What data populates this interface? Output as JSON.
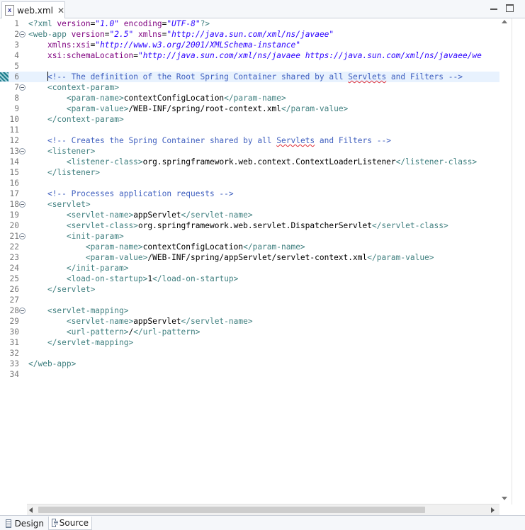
{
  "editor_tab": {
    "title": "web.xml",
    "file_icon": "xml-file-icon",
    "close_glyph": "✕"
  },
  "bottom_tabs": {
    "design": "Design",
    "source": "Source"
  },
  "colors": {
    "tag": "#3f7f7f",
    "attribute": "#7f007f",
    "value": "#2a00ff",
    "comment": "#3f5fbf",
    "text": "#000000",
    "line_number": "#787878",
    "current_line": "#e8f2fe"
  },
  "lines": [
    {
      "n": "1",
      "fold": false,
      "tokens": [
        {
          "t": "t",
          "s": "<?xml "
        },
        {
          "t": "a",
          "s": "version"
        },
        {
          "t": "x",
          "s": "="
        },
        {
          "t": "v",
          "s": "\"1.0\""
        },
        {
          "t": "x",
          "s": " "
        },
        {
          "t": "a",
          "s": "encoding"
        },
        {
          "t": "x",
          "s": "="
        },
        {
          "t": "v",
          "s": "\"UTF-8\""
        },
        {
          "t": "t",
          "s": "?>"
        }
      ]
    },
    {
      "n": "2",
      "fold": true,
      "tokens": [
        {
          "t": "t",
          "s": "<web-app "
        },
        {
          "t": "a",
          "s": "version"
        },
        {
          "t": "x",
          "s": "="
        },
        {
          "t": "v",
          "s": "\"2.5\""
        },
        {
          "t": "x",
          "s": " "
        },
        {
          "t": "a",
          "s": "xmlns"
        },
        {
          "t": "x",
          "s": "="
        },
        {
          "t": "v",
          "s": "\"http://java.sun.com/xml/ns/javaee\""
        }
      ]
    },
    {
      "n": "3",
      "fold": false,
      "tokens": [
        {
          "t": "x",
          "s": "    "
        },
        {
          "t": "a",
          "s": "xmlns:xsi"
        },
        {
          "t": "x",
          "s": "="
        },
        {
          "t": "v",
          "s": "\"http://www.w3.org/2001/XMLSchema-instance\""
        }
      ]
    },
    {
      "n": "4",
      "fold": false,
      "tokens": [
        {
          "t": "x",
          "s": "    "
        },
        {
          "t": "a",
          "s": "xsi:schemaLocation"
        },
        {
          "t": "x",
          "s": "="
        },
        {
          "t": "v",
          "s": "\"http://java.sun.com/xml/ns/javaee https://java.sun.com/xml/ns/javaee/we"
        }
      ]
    },
    {
      "n": "5",
      "fold": false,
      "tokens": []
    },
    {
      "n": "6",
      "fold": false,
      "current": true,
      "marker": true,
      "tokens": [
        {
          "t": "x",
          "s": "    "
        },
        {
          "t": "caret",
          "s": ""
        },
        {
          "t": "c",
          "s": "<!-- The definition of the Root Spring Container shared by all "
        },
        {
          "t": "c",
          "s": "Servlets",
          "squig": true
        },
        {
          "t": "c",
          "s": " and Filters -->"
        }
      ]
    },
    {
      "n": "7",
      "fold": true,
      "tokens": [
        {
          "t": "x",
          "s": "    "
        },
        {
          "t": "t",
          "s": "<context-param>"
        }
      ]
    },
    {
      "n": "8",
      "fold": false,
      "tokens": [
        {
          "t": "x",
          "s": "        "
        },
        {
          "t": "t",
          "s": "<param-name>"
        },
        {
          "t": "x",
          "s": "contextConfigLocation"
        },
        {
          "t": "t",
          "s": "</param-name>"
        }
      ]
    },
    {
      "n": "9",
      "fold": false,
      "tokens": [
        {
          "t": "x",
          "s": "        "
        },
        {
          "t": "t",
          "s": "<param-value>"
        },
        {
          "t": "x",
          "s": "/WEB-INF/spring/root-context.xml"
        },
        {
          "t": "t",
          "s": "</param-value>"
        }
      ]
    },
    {
      "n": "10",
      "fold": false,
      "tokens": [
        {
          "t": "x",
          "s": "    "
        },
        {
          "t": "t",
          "s": "</context-param>"
        }
      ]
    },
    {
      "n": "11",
      "fold": false,
      "tokens": []
    },
    {
      "n": "12",
      "fold": false,
      "tokens": [
        {
          "t": "x",
          "s": "    "
        },
        {
          "t": "c",
          "s": "<!-- Creates the Spring Container shared by all "
        },
        {
          "t": "c",
          "s": "Servlets",
          "squig": true
        },
        {
          "t": "c",
          "s": " and Filters -->"
        }
      ]
    },
    {
      "n": "13",
      "fold": true,
      "tokens": [
        {
          "t": "x",
          "s": "    "
        },
        {
          "t": "t",
          "s": "<listener>"
        }
      ]
    },
    {
      "n": "14",
      "fold": false,
      "tokens": [
        {
          "t": "x",
          "s": "        "
        },
        {
          "t": "t",
          "s": "<listener-class>"
        },
        {
          "t": "x",
          "s": "org.springframework.web.context.ContextLoaderListener"
        },
        {
          "t": "t",
          "s": "</listener-class>"
        }
      ]
    },
    {
      "n": "15",
      "fold": false,
      "tokens": [
        {
          "t": "x",
          "s": "    "
        },
        {
          "t": "t",
          "s": "</listener>"
        }
      ]
    },
    {
      "n": "16",
      "fold": false,
      "tokens": []
    },
    {
      "n": "17",
      "fold": false,
      "tokens": [
        {
          "t": "x",
          "s": "    "
        },
        {
          "t": "c",
          "s": "<!-- Processes application requests -->"
        }
      ]
    },
    {
      "n": "18",
      "fold": true,
      "tokens": [
        {
          "t": "x",
          "s": "    "
        },
        {
          "t": "t",
          "s": "<servlet>"
        }
      ]
    },
    {
      "n": "19",
      "fold": false,
      "tokens": [
        {
          "t": "x",
          "s": "        "
        },
        {
          "t": "t",
          "s": "<servlet-name>"
        },
        {
          "t": "x",
          "s": "appServlet"
        },
        {
          "t": "t",
          "s": "</servlet-name>"
        }
      ]
    },
    {
      "n": "20",
      "fold": false,
      "tokens": [
        {
          "t": "x",
          "s": "        "
        },
        {
          "t": "t",
          "s": "<servlet-class>"
        },
        {
          "t": "x",
          "s": "org.springframework.web.servlet.DispatcherServlet"
        },
        {
          "t": "t",
          "s": "</servlet-class>"
        }
      ]
    },
    {
      "n": "21",
      "fold": true,
      "tokens": [
        {
          "t": "x",
          "s": "        "
        },
        {
          "t": "t",
          "s": "<init-param>"
        }
      ]
    },
    {
      "n": "22",
      "fold": false,
      "tokens": [
        {
          "t": "x",
          "s": "            "
        },
        {
          "t": "t",
          "s": "<param-name>"
        },
        {
          "t": "x",
          "s": "contextConfigLocation"
        },
        {
          "t": "t",
          "s": "</param-name>"
        }
      ]
    },
    {
      "n": "23",
      "fold": false,
      "tokens": [
        {
          "t": "x",
          "s": "            "
        },
        {
          "t": "t",
          "s": "<param-value>"
        },
        {
          "t": "x",
          "s": "/WEB-INF/spring/appServlet/servlet-context.xml"
        },
        {
          "t": "t",
          "s": "</param-value>"
        }
      ]
    },
    {
      "n": "24",
      "fold": false,
      "tokens": [
        {
          "t": "x",
          "s": "        "
        },
        {
          "t": "t",
          "s": "</init-param>"
        }
      ]
    },
    {
      "n": "25",
      "fold": false,
      "tokens": [
        {
          "t": "x",
          "s": "        "
        },
        {
          "t": "t",
          "s": "<load-on-startup>"
        },
        {
          "t": "x",
          "s": "1"
        },
        {
          "t": "t",
          "s": "</load-on-startup>"
        }
      ]
    },
    {
      "n": "26",
      "fold": false,
      "tokens": [
        {
          "t": "x",
          "s": "    "
        },
        {
          "t": "t",
          "s": "</servlet>"
        }
      ]
    },
    {
      "n": "27",
      "fold": false,
      "tokens": []
    },
    {
      "n": "28",
      "fold": true,
      "tokens": [
        {
          "t": "x",
          "s": "    "
        },
        {
          "t": "t",
          "s": "<servlet-mapping>"
        }
      ]
    },
    {
      "n": "29",
      "fold": false,
      "tokens": [
        {
          "t": "x",
          "s": "        "
        },
        {
          "t": "t",
          "s": "<servlet-name>"
        },
        {
          "t": "x",
          "s": "appServlet"
        },
        {
          "t": "t",
          "s": "</servlet-name>"
        }
      ]
    },
    {
      "n": "30",
      "fold": false,
      "tokens": [
        {
          "t": "x",
          "s": "        "
        },
        {
          "t": "t",
          "s": "<url-pattern>"
        },
        {
          "t": "x",
          "s": "/"
        },
        {
          "t": "t",
          "s": "</url-pattern>"
        }
      ]
    },
    {
      "n": "31",
      "fold": false,
      "tokens": [
        {
          "t": "x",
          "s": "    "
        },
        {
          "t": "t",
          "s": "</servlet-mapping>"
        }
      ]
    },
    {
      "n": "32",
      "fold": false,
      "tokens": []
    },
    {
      "n": "33",
      "fold": false,
      "tokens": [
        {
          "t": "t",
          "s": "</web-app>"
        }
      ]
    },
    {
      "n": "34",
      "fold": false,
      "tokens": []
    }
  ]
}
